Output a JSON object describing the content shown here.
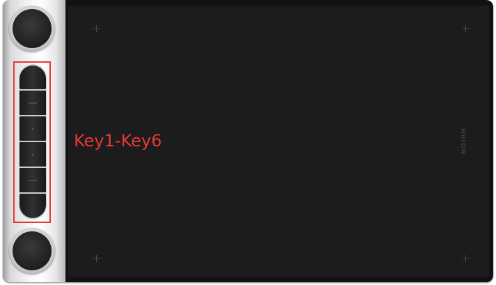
{
  "annotation": {
    "label": "Key1-Key6",
    "color": "#e53935"
  },
  "tablet": {
    "brand_text": "HUION",
    "body_color": "#121212",
    "work_area_color": "#1c1c1c"
  },
  "dials": [
    {
      "name": "top-dial",
      "icon": "dial-icon"
    },
    {
      "name": "bottom-dial",
      "icon": "dial-icon"
    }
  ],
  "keys": [
    {
      "id": "key-1",
      "mark": "none"
    },
    {
      "id": "key-2",
      "mark": "dash"
    },
    {
      "id": "key-3",
      "mark": "dot"
    },
    {
      "id": "key-4",
      "mark": "dot"
    },
    {
      "id": "key-5",
      "mark": "dash"
    },
    {
      "id": "key-6",
      "mark": "none"
    }
  ]
}
